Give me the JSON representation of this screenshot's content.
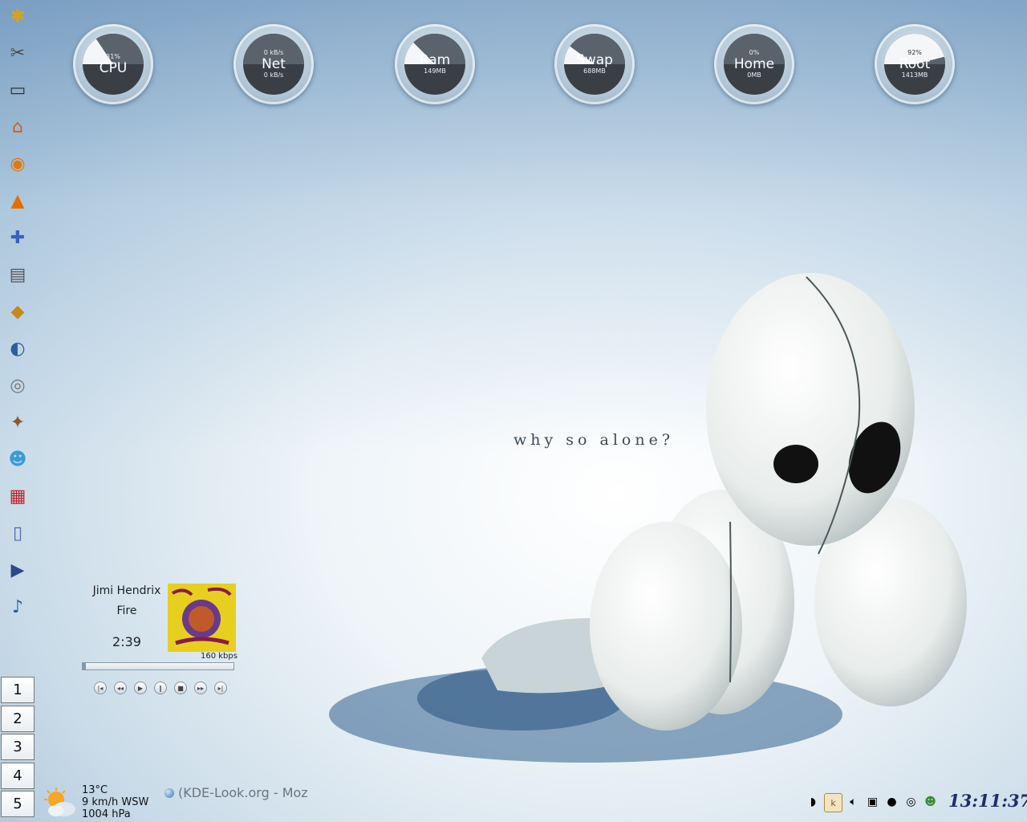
{
  "launcher": {
    "items": [
      {
        "name": "kde-menu-icon",
        "glyph": "✱"
      },
      {
        "name": "settings-tools-icon",
        "glyph": "✂"
      },
      {
        "name": "terminal-icon",
        "glyph": "▭"
      },
      {
        "name": "home-folder-icon",
        "glyph": "⌂"
      },
      {
        "name": "firefox-icon",
        "glyph": "◉"
      },
      {
        "name": "vlc-icon",
        "glyph": "▲"
      },
      {
        "name": "messenger-icon",
        "glyph": "✚"
      },
      {
        "name": "text-editor-icon",
        "glyph": "▤"
      },
      {
        "name": "graphics-app-icon",
        "glyph": "◆"
      },
      {
        "name": "fish-app-icon",
        "glyph": "◐"
      },
      {
        "name": "music-disc-icon",
        "glyph": "◎"
      },
      {
        "name": "mule-p2p-icon",
        "glyph": "✦"
      },
      {
        "name": "chat-contacts-icon",
        "glyph": "☻"
      },
      {
        "name": "calendar-app-icon",
        "glyph": "▦"
      },
      {
        "name": "notes-app-icon",
        "glyph": "▯"
      },
      {
        "name": "mplayer-icon",
        "glyph": "▶"
      },
      {
        "name": "speaker-icon",
        "glyph": "♪"
      }
    ]
  },
  "pager": {
    "desktops": [
      "1",
      "2",
      "3",
      "4",
      "5"
    ]
  },
  "gauges": [
    {
      "label": "CPU",
      "top": "31%",
      "bottom": "",
      "fill": 0.31,
      "dark": false
    },
    {
      "label": "Net",
      "top": "0 kB/s",
      "bottom": "0 kB/s",
      "fill": 0,
      "dark": false
    },
    {
      "label": "Ram",
      "top": "",
      "bottom": "149MB",
      "fill": 0.25,
      "dark": false
    },
    {
      "label": "Swap",
      "top": "",
      "bottom": "688MB",
      "fill": 0.2,
      "dark": false
    },
    {
      "label": "Home",
      "top": "0%",
      "bottom": "0MB",
      "fill": 0,
      "dark": false
    },
    {
      "label": "Root",
      "top": "92%",
      "bottom": "1413MB",
      "fill": 0.92,
      "dark": false
    }
  ],
  "wallpaper": {
    "tagline": "why so alone?"
  },
  "player": {
    "artist": "Jimi Hendrix",
    "song": "Fire",
    "time": "2:39",
    "bitrate": "160 kbps",
    "progress": 0.02
  },
  "weather": {
    "temperature": "13°C",
    "wind": "9 km/h WSW",
    "pressure": "1004 hPa"
  },
  "taskbar": {
    "window_title": "(KDE-Look.org - Moz"
  },
  "tray": {
    "icons": [
      "network-icon",
      "klipper-icon",
      "volume-icon",
      "window-list-icon",
      "bomb-icon",
      "cd-icon",
      "user-icon"
    ]
  },
  "clock": {
    "time": "13:11:37"
  }
}
